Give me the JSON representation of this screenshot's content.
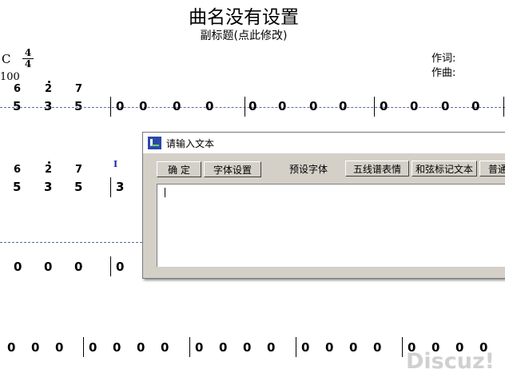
{
  "score": {
    "title": "曲名没有设置",
    "subtitle": "副标题(点此修改)",
    "lyricist_label": "作词:",
    "composer_label": "作曲:",
    "key": "C",
    "time_signature": {
      "top": "4",
      "bottom": "4"
    },
    "tempo": "100",
    "cursor_marker": "I",
    "row1": {
      "chord_tones": [
        "6",
        "2",
        "7"
      ],
      "bass_tones": [
        "5",
        "3",
        "5"
      ],
      "measures": [
        [
          "0",
          "0",
          "0",
          "0"
        ],
        [
          "0",
          "0",
          "0",
          "0"
        ],
        [
          "0",
          "0",
          "0",
          "0"
        ],
        [
          "0"
        ]
      ]
    },
    "row2": {
      "chord_tones": [
        "6",
        "2",
        "7"
      ],
      "bass_tones": [
        "5",
        "3",
        "5"
      ],
      "first_note": "3"
    },
    "row3": {
      "notes": [
        "0",
        "0",
        "0"
      ],
      "after_bar": "0"
    },
    "row4": {
      "measures": [
        [
          "0",
          "0",
          "0"
        ],
        [
          "0",
          "0",
          "0",
          "0"
        ],
        [
          "0",
          "0",
          "0",
          "0"
        ],
        [
          "0",
          "0",
          "0",
          "0"
        ],
        [
          "0",
          "0",
          "0",
          "0"
        ]
      ]
    }
  },
  "dialog": {
    "title": "请输入文本",
    "ok_label": "确 定",
    "font_settings_label": "字体设置",
    "preset_font_label": "预设字体",
    "staff_expression_label": "五线谱表情",
    "chord_text_label": "和弦标记文本",
    "normal_label": "普通",
    "text_value": ""
  },
  "watermark": "Discuz!",
  "colors": {
    "dialog_bg": "#d4d0c8",
    "dashed_line": "#5a6aa0",
    "cursor_marker": "#1a2aa0"
  }
}
